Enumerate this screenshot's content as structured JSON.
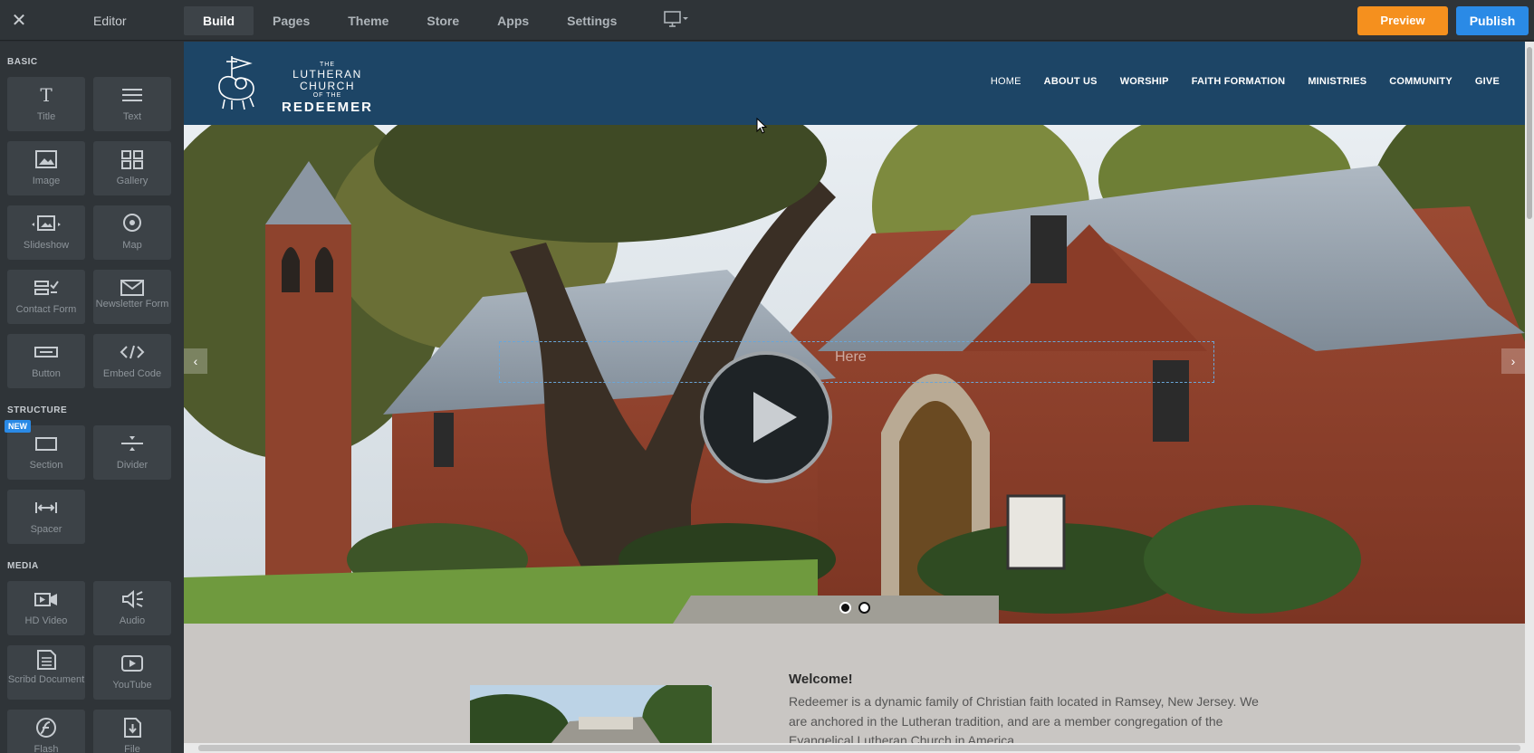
{
  "topbar": {
    "editor_label": "Editor",
    "tabs": [
      {
        "label": "Build"
      },
      {
        "label": "Pages"
      },
      {
        "label": "Theme"
      },
      {
        "label": "Store"
      },
      {
        "label": "Apps"
      },
      {
        "label": "Settings"
      }
    ],
    "preview_label": "Preview",
    "publish_label": "Publish",
    "accent_preview": "#f5901e",
    "accent_publish": "#2a8ae6"
  },
  "sidebar": {
    "basic_title": "BASIC",
    "structure_title": "STRUCTURE",
    "media_title": "MEDIA",
    "new_badge": "NEW",
    "basic": [
      {
        "label": "Title",
        "icon": "title-icon"
      },
      {
        "label": "Text",
        "icon": "text-icon"
      },
      {
        "label": "Image",
        "icon": "image-icon"
      },
      {
        "label": "Gallery",
        "icon": "gallery-icon"
      },
      {
        "label": "Slideshow",
        "icon": "slideshow-icon"
      },
      {
        "label": "Map",
        "icon": "map-pin-icon"
      },
      {
        "label": "Contact Form",
        "icon": "contact-form-icon"
      },
      {
        "label": "Newsletter Form",
        "icon": "envelope-icon"
      },
      {
        "label": "Button",
        "icon": "button-icon"
      },
      {
        "label": "Embed Code",
        "icon": "code-icon"
      }
    ],
    "structure": [
      {
        "label": "Section",
        "icon": "section-icon"
      },
      {
        "label": "Divider",
        "icon": "divider-icon"
      },
      {
        "label": "Spacer",
        "icon": "spacer-icon"
      }
    ],
    "media": [
      {
        "label": "HD Video",
        "icon": "video-icon"
      },
      {
        "label": "Audio",
        "icon": "audio-icon"
      },
      {
        "label": "Scribd Document",
        "icon": "document-icon"
      },
      {
        "label": "YouTube",
        "icon": "youtube-icon"
      },
      {
        "label": "Flash",
        "icon": "flash-icon"
      },
      {
        "label": "File",
        "icon": "file-icon"
      }
    ]
  },
  "site": {
    "logo": {
      "line1": "THE",
      "line2": "LUTHERAN CHURCH",
      "line3": "OF THE",
      "line4": "REDEEMER"
    },
    "nav": [
      "HOME",
      "ABOUT US",
      "WORSHIP",
      "FAITH FORMATION",
      "MINISTRIES",
      "COMMUNITY",
      "GIVE"
    ],
    "header_color": "#1d4566",
    "hero": {
      "heading_placeholder": "Here",
      "arrow_left": "‹",
      "arrow_right": "›"
    },
    "welcome": {
      "title": "Welcome!",
      "body": "Redeemer is a dynamic family of Christian faith located in Ramsey, New Jersey. We are anchored in the Lutheran tradition, and are a member congregation of the Evangelical Lutheran Church in America."
    }
  }
}
